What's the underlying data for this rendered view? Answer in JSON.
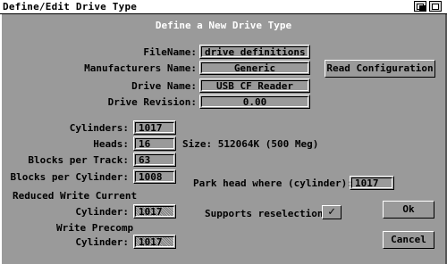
{
  "window": {
    "title": "Define/Edit Drive Type",
    "heading": "Define a New Drive Type"
  },
  "fields": {
    "filename_label": "FileName:",
    "filename_value": "drive definitions",
    "manufacturer_label": "Manufacturers Name:",
    "manufacturer_value": "Generic",
    "drive_name_label": "Drive Name:",
    "drive_name_value": "USB CF Reader",
    "drive_revision_label": "Drive Revision:",
    "drive_revision_value": "0.00",
    "cylinders_label": "Cylinders:",
    "cylinders_value": "1017",
    "heads_label": "Heads:",
    "heads_value": "16",
    "size_text": "Size: 512064K (500 Meg)",
    "blocks_per_track_label": "Blocks per Track:",
    "blocks_per_track_value": "63",
    "blocks_per_cylinder_label": "Blocks per Cylinder:",
    "blocks_per_cylinder_value": "1008",
    "park_head_label": "Park head where (cylinder):",
    "park_head_value": "1017",
    "reduced_write_label": "Reduced Write Current",
    "reduced_write_cyl_label": "Cylinder:",
    "reduced_write_value": "1017",
    "supports_reselection_label": "Supports reselection",
    "supports_reselection_checked": "✓",
    "write_precomp_label": "Write Precomp",
    "write_precomp_cyl_label": "Cylinder:",
    "write_precomp_value": "1017"
  },
  "buttons": {
    "read_configuration": "Read Configuration",
    "ok": "Ok",
    "cancel": "Cancel"
  }
}
